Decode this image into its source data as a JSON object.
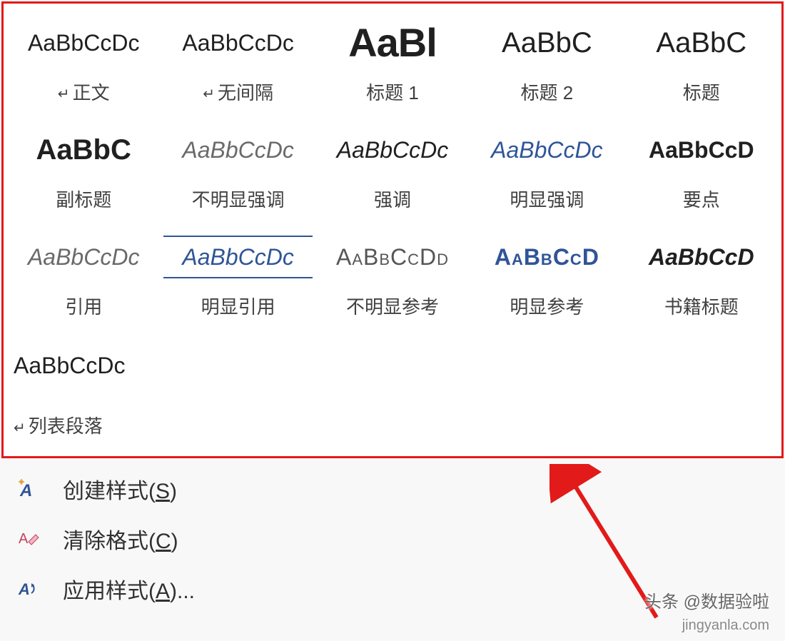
{
  "styles": [
    {
      "id": "normal",
      "preview": "AaBbCcDc",
      "label": "正文",
      "pilcrow": true,
      "cls": ""
    },
    {
      "id": "no-spacing",
      "preview": "AaBbCcDc",
      "label": "无间隔",
      "pilcrow": true,
      "cls": ""
    },
    {
      "id": "heading-1",
      "preview": "AaBl",
      "label": "标题 1",
      "pilcrow": false,
      "cls": "pv-heading1"
    },
    {
      "id": "heading-2",
      "preview": "AaBbC",
      "label": "标题 2",
      "pilcrow": false,
      "cls": "pv-heading2"
    },
    {
      "id": "title",
      "preview": "AaBbC",
      "label": "标题",
      "pilcrow": false,
      "cls": "pv-title"
    },
    {
      "id": "subtitle",
      "preview": "AaBbC",
      "label": "副标题",
      "pilcrow": false,
      "cls": "pv-subtitle"
    },
    {
      "id": "subtle-emph",
      "preview": "AaBbCcDc",
      "label": "不明显强调",
      "pilcrow": false,
      "cls": "pv-subtle-emph"
    },
    {
      "id": "emphasis",
      "preview": "AaBbCcDc",
      "label": "强调",
      "pilcrow": false,
      "cls": "pv-emph"
    },
    {
      "id": "intense-emph",
      "preview": "AaBbCcDc",
      "label": "明显强调",
      "pilcrow": false,
      "cls": "pv-intense-emph"
    },
    {
      "id": "strong",
      "preview": "AaBbCcD",
      "label": "要点",
      "pilcrow": false,
      "cls": "pv-strong"
    },
    {
      "id": "quote",
      "preview": "AaBbCcDc",
      "label": "引用",
      "pilcrow": false,
      "cls": "pv-quote"
    },
    {
      "id": "intense-quote",
      "preview": "AaBbCcDc",
      "label": "明显引用",
      "pilcrow": false,
      "cls": "pv-intense-quote"
    },
    {
      "id": "subtle-ref",
      "preview": "AaBbCcDd",
      "label": "不明显参考",
      "pilcrow": false,
      "cls": "pv-subtle-ref"
    },
    {
      "id": "intense-ref",
      "preview": "AaBbCcD",
      "label": "明显参考",
      "pilcrow": false,
      "cls": "pv-intense-ref"
    },
    {
      "id": "book-title",
      "preview": "AaBbCcD",
      "label": "书籍标题",
      "pilcrow": false,
      "cls": "pv-book-title"
    },
    {
      "id": "list-paragraph",
      "preview": "AaBbCcDc",
      "label": "列表段落",
      "pilcrow": true,
      "cls": "",
      "row4": true
    }
  ],
  "menu": {
    "create_style": {
      "text": "创建样式(",
      "hotkey": "S",
      "suffix": ")"
    },
    "clear_format": {
      "text": "清除格式(",
      "hotkey": "C",
      "suffix": ")"
    },
    "apply_style": {
      "text": "应用样式(",
      "hotkey": "A",
      "suffix": ")..."
    }
  },
  "watermark1": "头条 @数据验啦",
  "watermark2": "jingyanla.com",
  "colors": {
    "highlight": "#e21a1a",
    "link": "#2f5597",
    "arrow": "#e21a1a"
  }
}
